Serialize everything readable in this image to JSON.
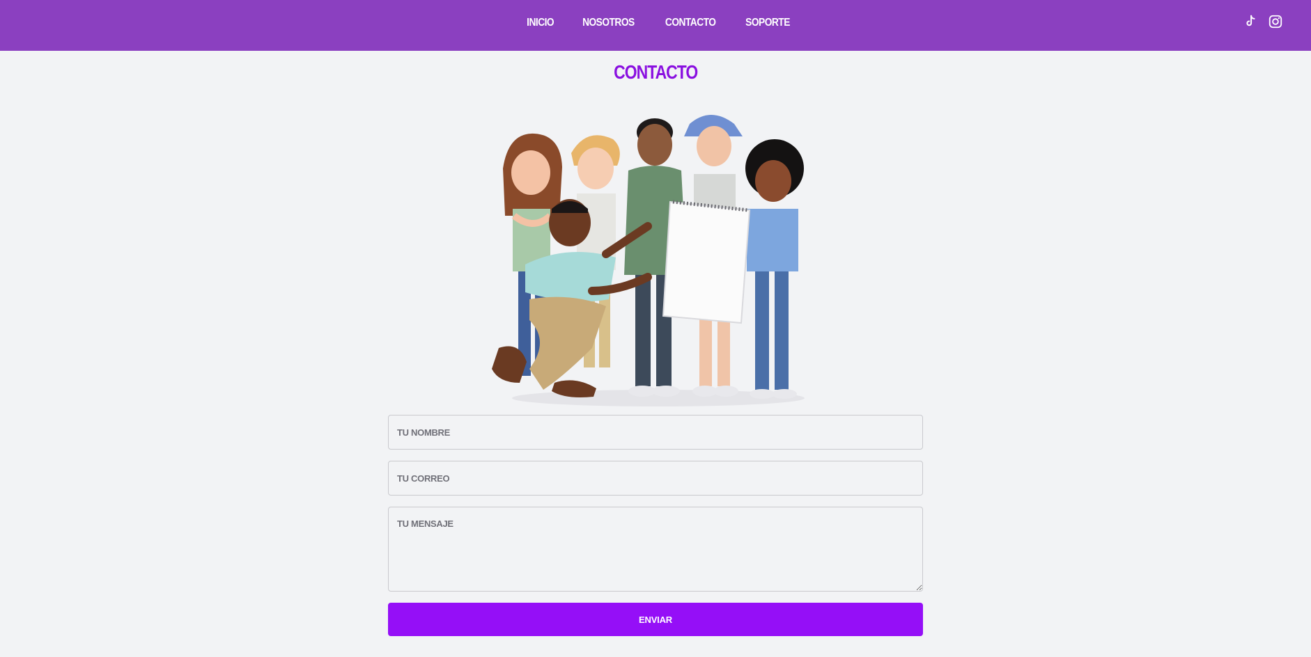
{
  "nav": {
    "links": [
      "INICIO",
      "NOSOTROS",
      "CONTACTO",
      "SOPORTE"
    ],
    "social_icons": [
      "tiktok-icon",
      "instagram-icon"
    ]
  },
  "page": {
    "title": "CONTACTO"
  },
  "form": {
    "name_placeholder": "TU NOMBRE",
    "email_placeholder": "TU CORREO",
    "message_placeholder": "TU MENSAJE",
    "submit_label": "ENVIAR"
  },
  "colors": {
    "navbar": "#8b40c0",
    "title": "#8a10e0",
    "button": "#950ff7",
    "background": "#f2f3f5"
  }
}
